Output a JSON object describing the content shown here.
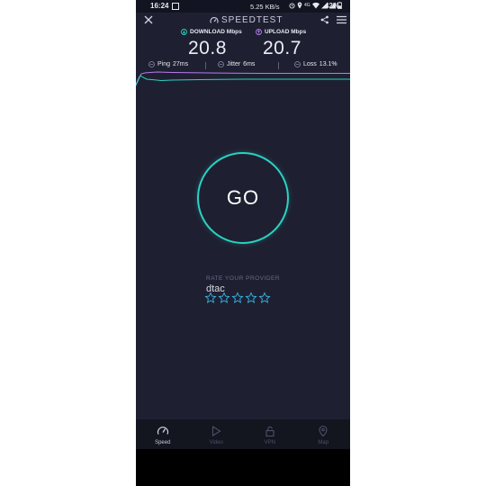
{
  "status_bar": {
    "time": "16:24",
    "net_speed": "5.25 KB/s",
    "signal_label": "4G",
    "battery": "42%"
  },
  "app": {
    "brand": "SPEEDTEST"
  },
  "results": {
    "download": {
      "label": "DOWNLOAD Mbps",
      "value": "20.8"
    },
    "upload": {
      "label": "UPLOAD Mbps",
      "value": "20.7"
    },
    "ping": {
      "label": "Ping",
      "value": "27ms"
    },
    "jitter": {
      "label": "Jitter",
      "value": "6ms"
    },
    "loss": {
      "label": "Loss",
      "value": "13.1%"
    }
  },
  "go_button": {
    "label": "GO"
  },
  "rating": {
    "title": "RATE YOUR PROVIDER",
    "provider": "dtac",
    "max_stars": 5
  },
  "bottom_nav": [
    {
      "label": "Speed",
      "active": true
    },
    {
      "label": "Video",
      "active": false
    },
    {
      "label": "VPN",
      "active": false
    },
    {
      "label": "Map",
      "active": false
    }
  ],
  "colors": {
    "background": "#1e2031",
    "download": "#2bd2c2",
    "upload": "#b77bf0",
    "accent": "#2bd2c2",
    "star": "#3ab5e6"
  }
}
